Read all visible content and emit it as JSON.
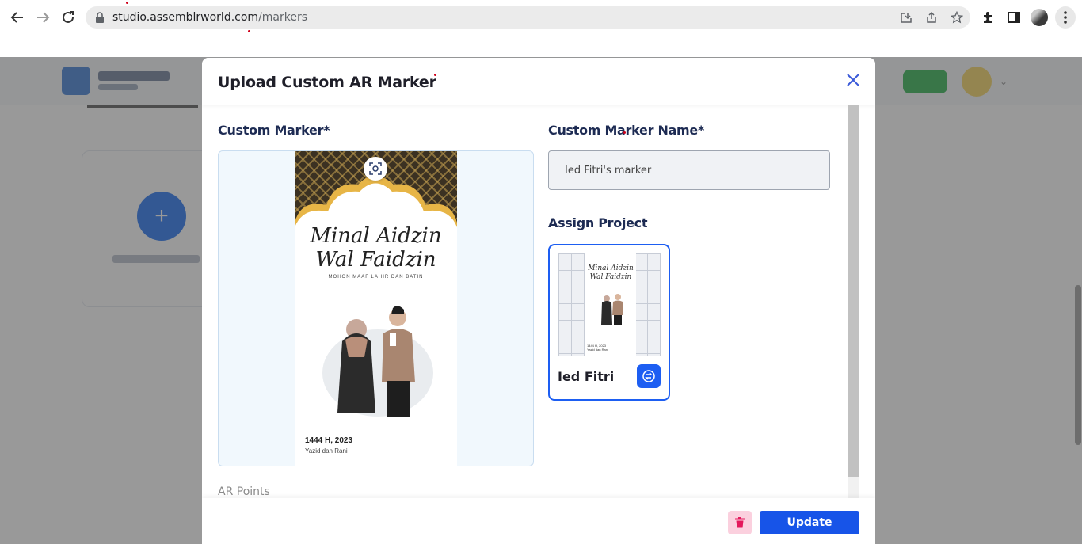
{
  "browser": {
    "url_host": "studio.assemblrworld.com",
    "url_path": "/markers"
  },
  "modal": {
    "title": "Upload Custom AR Marker",
    "custom_marker_label": "Custom Marker*",
    "marker_name_label": "Custom Marker Name*",
    "marker_name_value": "Ied Fitri's marker",
    "assign_project_label": "Assign Project",
    "ar_points_label": "AR Points",
    "update_label": "Update"
  },
  "marker_image": {
    "line1": "Minal Aidzin",
    "line2": "Wal Faidzin",
    "subtitle": "MOHON MAAF LAHIR DAN BATIN",
    "year": "1444 H, 2023",
    "names": "Yazid dan Rani"
  },
  "project": {
    "name": "Ied Fitri",
    "thumb_line1": "Minal Aidzin",
    "thumb_line2": "Wal Faidzin",
    "thumb_year": "1444 H, 2023",
    "thumb_names": "Yazid dan Rani"
  },
  "colors": {
    "primary": "#1d5ef2",
    "update": "#1754e8",
    "delete_bg": "#fbd0de"
  }
}
